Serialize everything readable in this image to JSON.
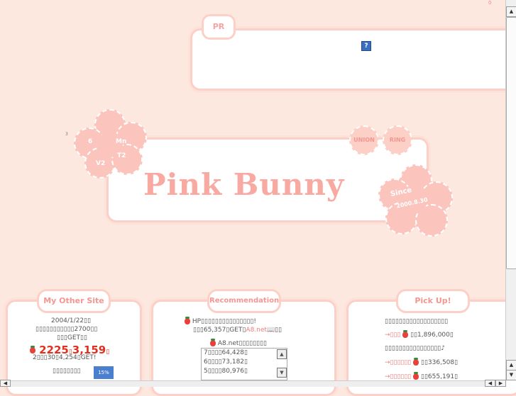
{
  "corner_mark": "0",
  "tiny_mark": "3",
  "pr": {
    "tab_label": "PR",
    "icon_glyph": "?"
  },
  "banner": {
    "title": "Pink Bunny",
    "flower_labels": [
      "6",
      "Mn",
      "V2",
      "T2"
    ],
    "union_label": "UNION",
    "ring_label": "RING",
    "since_line1": "Since",
    "since_line2": "2000.8.30"
  },
  "other_site": {
    "tab_label": "My Other Site",
    "lines": [
      "2004/1/22▯▯",
      "▯▯▯▯▯▯▯▯▯▯▯2700▯▯",
      "▯▯▯GET▯▯"
    ],
    "big_number_a": "2225",
    "big_number_b": "3,159",
    "line_get": "2▯▯▯30▯4,254▯GET!",
    "last_line": "▯▯▯▯▯▯▯▯",
    "badge": "15%"
  },
  "recommendation": {
    "tab_label": "Recommendation",
    "line1": "HP▯▯▯▯▯▯▯▯▯▯▯▯▯▯▯!",
    "line2_prefix": "▯▯▯65,357▯GET▯",
    "line2_link": "A8.net",
    "line3": "A8.net▯▯▯▯▯▯▯▯",
    "list": [
      "7▯▯▯▯64,428▯",
      "6▯▯▯▯73,182▯",
      "5▯▯▯▯80,976▯"
    ]
  },
  "pickup": {
    "tab_label": "Pick Up!",
    "line1": "▯▯▯▯▯▯▯▯▯▯▯▯▯▯▯▯▯▯",
    "row1_link": "→▯▯▯",
    "row1_value": "▯▯1,896,000▯",
    "line2": "▯▯▯▯▯▯▯▯▯▯▯▯▯▯▯▯♪",
    "row2_link": "→▯▯▯▯▯▯",
    "row2_value": "▯▯336,508▯",
    "row3_link": "→▯▯▯▯▯▯",
    "row3_value": "▯▯655,191▯"
  },
  "scroll": {
    "up": "▲",
    "down": "▼",
    "left": "◀",
    "right": "▶"
  }
}
